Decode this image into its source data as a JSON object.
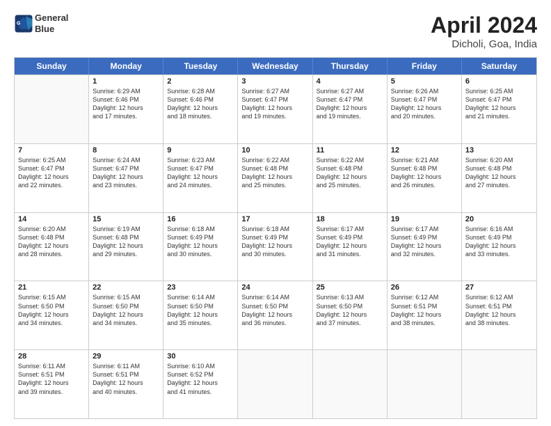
{
  "logo": {
    "line1": "General",
    "line2": "Blue"
  },
  "title": "April 2024",
  "subtitle": "Dicholi, Goa, India",
  "col_headers": [
    "Sunday",
    "Monday",
    "Tuesday",
    "Wednesday",
    "Thursday",
    "Friday",
    "Saturday"
  ],
  "rows": [
    [
      {
        "day": "",
        "sunrise": "",
        "sunset": "",
        "daylight": "",
        "empty": true
      },
      {
        "day": "1",
        "sunrise": "Sunrise: 6:29 AM",
        "sunset": "Sunset: 6:46 PM",
        "daylight": "Daylight: 12 hours",
        "daylight2": "and 17 minutes."
      },
      {
        "day": "2",
        "sunrise": "Sunrise: 6:28 AM",
        "sunset": "Sunset: 6:46 PM",
        "daylight": "Daylight: 12 hours",
        "daylight2": "and 18 minutes."
      },
      {
        "day": "3",
        "sunrise": "Sunrise: 6:27 AM",
        "sunset": "Sunset: 6:47 PM",
        "daylight": "Daylight: 12 hours",
        "daylight2": "and 19 minutes."
      },
      {
        "day": "4",
        "sunrise": "Sunrise: 6:27 AM",
        "sunset": "Sunset: 6:47 PM",
        "daylight": "Daylight: 12 hours",
        "daylight2": "and 19 minutes."
      },
      {
        "day": "5",
        "sunrise": "Sunrise: 6:26 AM",
        "sunset": "Sunset: 6:47 PM",
        "daylight": "Daylight: 12 hours",
        "daylight2": "and 20 minutes."
      },
      {
        "day": "6",
        "sunrise": "Sunrise: 6:25 AM",
        "sunset": "Sunset: 6:47 PM",
        "daylight": "Daylight: 12 hours",
        "daylight2": "and 21 minutes."
      }
    ],
    [
      {
        "day": "7",
        "sunrise": "Sunrise: 6:25 AM",
        "sunset": "Sunset: 6:47 PM",
        "daylight": "Daylight: 12 hours",
        "daylight2": "and 22 minutes."
      },
      {
        "day": "8",
        "sunrise": "Sunrise: 6:24 AM",
        "sunset": "Sunset: 6:47 PM",
        "daylight": "Daylight: 12 hours",
        "daylight2": "and 23 minutes."
      },
      {
        "day": "9",
        "sunrise": "Sunrise: 6:23 AM",
        "sunset": "Sunset: 6:47 PM",
        "daylight": "Daylight: 12 hours",
        "daylight2": "and 24 minutes."
      },
      {
        "day": "10",
        "sunrise": "Sunrise: 6:22 AM",
        "sunset": "Sunset: 6:48 PM",
        "daylight": "Daylight: 12 hours",
        "daylight2": "and 25 minutes."
      },
      {
        "day": "11",
        "sunrise": "Sunrise: 6:22 AM",
        "sunset": "Sunset: 6:48 PM",
        "daylight": "Daylight: 12 hours",
        "daylight2": "and 25 minutes."
      },
      {
        "day": "12",
        "sunrise": "Sunrise: 6:21 AM",
        "sunset": "Sunset: 6:48 PM",
        "daylight": "Daylight: 12 hours",
        "daylight2": "and 26 minutes."
      },
      {
        "day": "13",
        "sunrise": "Sunrise: 6:20 AM",
        "sunset": "Sunset: 6:48 PM",
        "daylight": "Daylight: 12 hours",
        "daylight2": "and 27 minutes."
      }
    ],
    [
      {
        "day": "14",
        "sunrise": "Sunrise: 6:20 AM",
        "sunset": "Sunset: 6:48 PM",
        "daylight": "Daylight: 12 hours",
        "daylight2": "and 28 minutes."
      },
      {
        "day": "15",
        "sunrise": "Sunrise: 6:19 AM",
        "sunset": "Sunset: 6:48 PM",
        "daylight": "Daylight: 12 hours",
        "daylight2": "and 29 minutes."
      },
      {
        "day": "16",
        "sunrise": "Sunrise: 6:18 AM",
        "sunset": "Sunset: 6:49 PM",
        "daylight": "Daylight: 12 hours",
        "daylight2": "and 30 minutes."
      },
      {
        "day": "17",
        "sunrise": "Sunrise: 6:18 AM",
        "sunset": "Sunset: 6:49 PM",
        "daylight": "Daylight: 12 hours",
        "daylight2": "and 30 minutes."
      },
      {
        "day": "18",
        "sunrise": "Sunrise: 6:17 AM",
        "sunset": "Sunset: 6:49 PM",
        "daylight": "Daylight: 12 hours",
        "daylight2": "and 31 minutes."
      },
      {
        "day": "19",
        "sunrise": "Sunrise: 6:17 AM",
        "sunset": "Sunset: 6:49 PM",
        "daylight": "Daylight: 12 hours",
        "daylight2": "and 32 minutes."
      },
      {
        "day": "20",
        "sunrise": "Sunrise: 6:16 AM",
        "sunset": "Sunset: 6:49 PM",
        "daylight": "Daylight: 12 hours",
        "daylight2": "and 33 minutes."
      }
    ],
    [
      {
        "day": "21",
        "sunrise": "Sunrise: 6:15 AM",
        "sunset": "Sunset: 6:50 PM",
        "daylight": "Daylight: 12 hours",
        "daylight2": "and 34 minutes."
      },
      {
        "day": "22",
        "sunrise": "Sunrise: 6:15 AM",
        "sunset": "Sunset: 6:50 PM",
        "daylight": "Daylight: 12 hours",
        "daylight2": "and 34 minutes."
      },
      {
        "day": "23",
        "sunrise": "Sunrise: 6:14 AM",
        "sunset": "Sunset: 6:50 PM",
        "daylight": "Daylight: 12 hours",
        "daylight2": "and 35 minutes."
      },
      {
        "day": "24",
        "sunrise": "Sunrise: 6:14 AM",
        "sunset": "Sunset: 6:50 PM",
        "daylight": "Daylight: 12 hours",
        "daylight2": "and 36 minutes."
      },
      {
        "day": "25",
        "sunrise": "Sunrise: 6:13 AM",
        "sunset": "Sunset: 6:50 PM",
        "daylight": "Daylight: 12 hours",
        "daylight2": "and 37 minutes."
      },
      {
        "day": "26",
        "sunrise": "Sunrise: 6:12 AM",
        "sunset": "Sunset: 6:51 PM",
        "daylight": "Daylight: 12 hours",
        "daylight2": "and 38 minutes."
      },
      {
        "day": "27",
        "sunrise": "Sunrise: 6:12 AM",
        "sunset": "Sunset: 6:51 PM",
        "daylight": "Daylight: 12 hours",
        "daylight2": "and 38 minutes."
      }
    ],
    [
      {
        "day": "28",
        "sunrise": "Sunrise: 6:11 AM",
        "sunset": "Sunset: 6:51 PM",
        "daylight": "Daylight: 12 hours",
        "daylight2": "and 39 minutes."
      },
      {
        "day": "29",
        "sunrise": "Sunrise: 6:11 AM",
        "sunset": "Sunset: 6:51 PM",
        "daylight": "Daylight: 12 hours",
        "daylight2": "and 40 minutes."
      },
      {
        "day": "30",
        "sunrise": "Sunrise: 6:10 AM",
        "sunset": "Sunset: 6:52 PM",
        "daylight": "Daylight: 12 hours",
        "daylight2": "and 41 minutes."
      },
      {
        "day": "",
        "sunrise": "",
        "sunset": "",
        "daylight": "",
        "daylight2": "",
        "empty": true
      },
      {
        "day": "",
        "sunrise": "",
        "sunset": "",
        "daylight": "",
        "daylight2": "",
        "empty": true
      },
      {
        "day": "",
        "sunrise": "",
        "sunset": "",
        "daylight": "",
        "daylight2": "",
        "empty": true
      },
      {
        "day": "",
        "sunrise": "",
        "sunset": "",
        "daylight": "",
        "daylight2": "",
        "empty": true
      }
    ]
  ]
}
